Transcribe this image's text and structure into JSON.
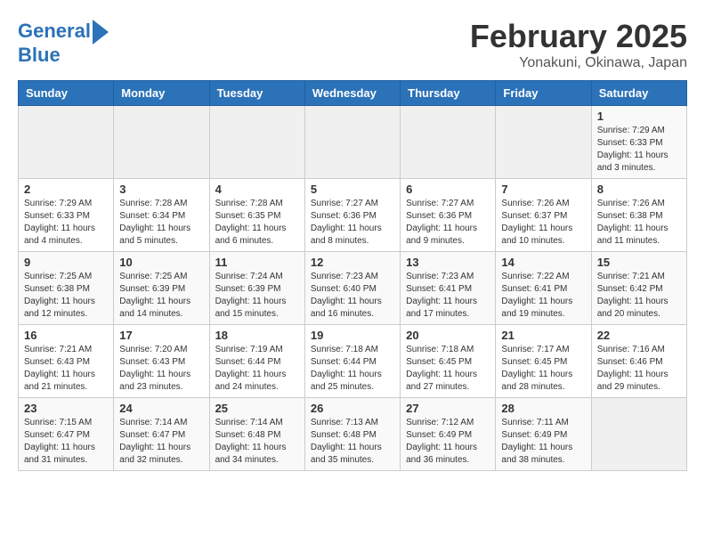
{
  "header": {
    "logo_line1": "General",
    "logo_line2": "Blue",
    "month_title": "February 2025",
    "location": "Yonakuni, Okinawa, Japan"
  },
  "days_of_week": [
    "Sunday",
    "Monday",
    "Tuesday",
    "Wednesday",
    "Thursday",
    "Friday",
    "Saturday"
  ],
  "weeks": [
    [
      {
        "day": "",
        "info": ""
      },
      {
        "day": "",
        "info": ""
      },
      {
        "day": "",
        "info": ""
      },
      {
        "day": "",
        "info": ""
      },
      {
        "day": "",
        "info": ""
      },
      {
        "day": "",
        "info": ""
      },
      {
        "day": "1",
        "info": "Sunrise: 7:29 AM\nSunset: 6:33 PM\nDaylight: 11 hours\nand 3 minutes."
      }
    ],
    [
      {
        "day": "2",
        "info": "Sunrise: 7:29 AM\nSunset: 6:33 PM\nDaylight: 11 hours\nand 4 minutes."
      },
      {
        "day": "3",
        "info": "Sunrise: 7:28 AM\nSunset: 6:34 PM\nDaylight: 11 hours\nand 5 minutes."
      },
      {
        "day": "4",
        "info": "Sunrise: 7:28 AM\nSunset: 6:35 PM\nDaylight: 11 hours\nand 6 minutes."
      },
      {
        "day": "5",
        "info": "Sunrise: 7:27 AM\nSunset: 6:36 PM\nDaylight: 11 hours\nand 8 minutes."
      },
      {
        "day": "6",
        "info": "Sunrise: 7:27 AM\nSunset: 6:36 PM\nDaylight: 11 hours\nand 9 minutes."
      },
      {
        "day": "7",
        "info": "Sunrise: 7:26 AM\nSunset: 6:37 PM\nDaylight: 11 hours\nand 10 minutes."
      },
      {
        "day": "8",
        "info": "Sunrise: 7:26 AM\nSunset: 6:38 PM\nDaylight: 11 hours\nand 11 minutes."
      }
    ],
    [
      {
        "day": "9",
        "info": "Sunrise: 7:25 AM\nSunset: 6:38 PM\nDaylight: 11 hours\nand 12 minutes."
      },
      {
        "day": "10",
        "info": "Sunrise: 7:25 AM\nSunset: 6:39 PM\nDaylight: 11 hours\nand 14 minutes."
      },
      {
        "day": "11",
        "info": "Sunrise: 7:24 AM\nSunset: 6:39 PM\nDaylight: 11 hours\nand 15 minutes."
      },
      {
        "day": "12",
        "info": "Sunrise: 7:23 AM\nSunset: 6:40 PM\nDaylight: 11 hours\nand 16 minutes."
      },
      {
        "day": "13",
        "info": "Sunrise: 7:23 AM\nSunset: 6:41 PM\nDaylight: 11 hours\nand 17 minutes."
      },
      {
        "day": "14",
        "info": "Sunrise: 7:22 AM\nSunset: 6:41 PM\nDaylight: 11 hours\nand 19 minutes."
      },
      {
        "day": "15",
        "info": "Sunrise: 7:21 AM\nSunset: 6:42 PM\nDaylight: 11 hours\nand 20 minutes."
      }
    ],
    [
      {
        "day": "16",
        "info": "Sunrise: 7:21 AM\nSunset: 6:43 PM\nDaylight: 11 hours\nand 21 minutes."
      },
      {
        "day": "17",
        "info": "Sunrise: 7:20 AM\nSunset: 6:43 PM\nDaylight: 11 hours\nand 23 minutes."
      },
      {
        "day": "18",
        "info": "Sunrise: 7:19 AM\nSunset: 6:44 PM\nDaylight: 11 hours\nand 24 minutes."
      },
      {
        "day": "19",
        "info": "Sunrise: 7:18 AM\nSunset: 6:44 PM\nDaylight: 11 hours\nand 25 minutes."
      },
      {
        "day": "20",
        "info": "Sunrise: 7:18 AM\nSunset: 6:45 PM\nDaylight: 11 hours\nand 27 minutes."
      },
      {
        "day": "21",
        "info": "Sunrise: 7:17 AM\nSunset: 6:45 PM\nDaylight: 11 hours\nand 28 minutes."
      },
      {
        "day": "22",
        "info": "Sunrise: 7:16 AM\nSunset: 6:46 PM\nDaylight: 11 hours\nand 29 minutes."
      }
    ],
    [
      {
        "day": "23",
        "info": "Sunrise: 7:15 AM\nSunset: 6:47 PM\nDaylight: 11 hours\nand 31 minutes."
      },
      {
        "day": "24",
        "info": "Sunrise: 7:14 AM\nSunset: 6:47 PM\nDaylight: 11 hours\nand 32 minutes."
      },
      {
        "day": "25",
        "info": "Sunrise: 7:14 AM\nSunset: 6:48 PM\nDaylight: 11 hours\nand 34 minutes."
      },
      {
        "day": "26",
        "info": "Sunrise: 7:13 AM\nSunset: 6:48 PM\nDaylight: 11 hours\nand 35 minutes."
      },
      {
        "day": "27",
        "info": "Sunrise: 7:12 AM\nSunset: 6:49 PM\nDaylight: 11 hours\nand 36 minutes."
      },
      {
        "day": "28",
        "info": "Sunrise: 7:11 AM\nSunset: 6:49 PM\nDaylight: 11 hours\nand 38 minutes."
      },
      {
        "day": "",
        "info": ""
      }
    ]
  ]
}
